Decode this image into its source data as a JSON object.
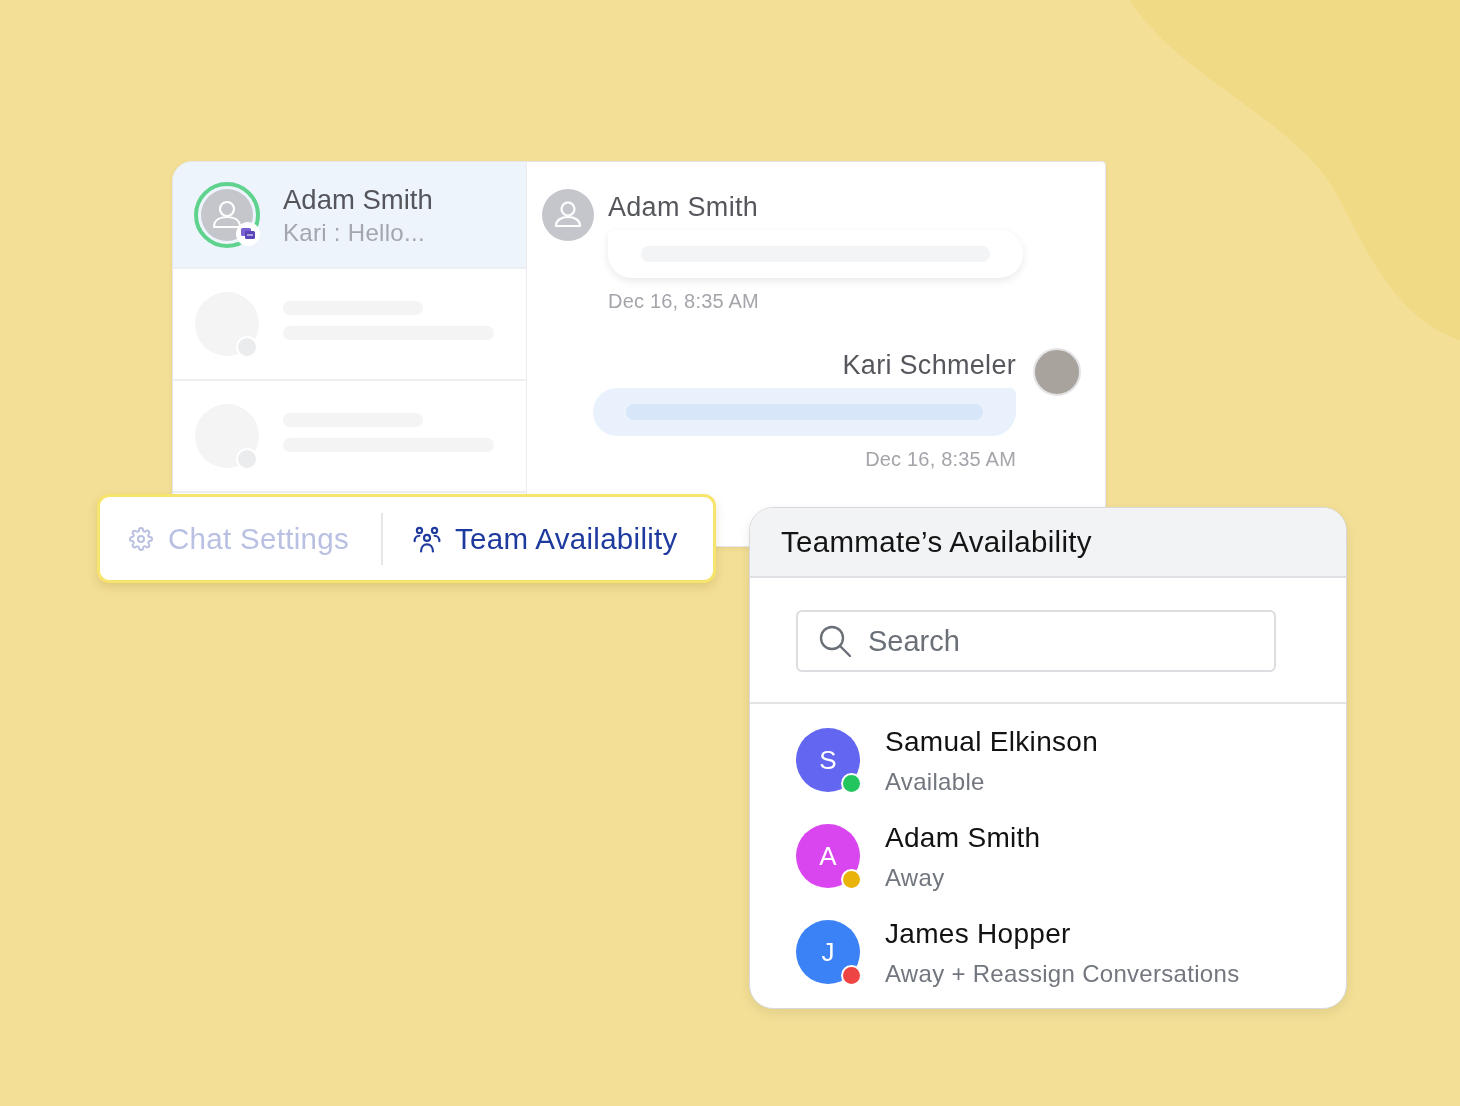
{
  "conversations": [
    {
      "kind": "contact",
      "name": "Adam Smith",
      "preview": "Kari : Hello...",
      "selected": true
    },
    {
      "kind": "placeholder",
      "selected": false
    },
    {
      "kind": "placeholder",
      "selected": false
    }
  ],
  "messages": [
    {
      "kind": "incoming",
      "sender": "Adam Smith",
      "time": "Dec 16, 8:35 AM"
    },
    {
      "kind": "outgoing",
      "sender": "Kari Schmeler",
      "time": "Dec 16, 8:35 AM"
    }
  ],
  "toolbar": {
    "tabs": [
      {
        "kind": "settings",
        "label": "Chat Settings",
        "selected": false
      },
      {
        "kind": "team",
        "label": "Team Availability",
        "selected": true
      }
    ]
  },
  "availability": {
    "title": "Teammate’s Availability",
    "search": {
      "placeholder": "Search"
    },
    "teammates": [
      {
        "name": "Samual Elkinson",
        "avatar": {
          "initial": "S",
          "color": "#6366f1"
        },
        "status": {
          "label": "Available",
          "color": "#22c55e"
        }
      },
      {
        "name": "Adam Smith",
        "avatar": {
          "initial": "A",
          "color": "#d946ef"
        },
        "status": {
          "label": "Away",
          "color": "#eab308"
        }
      },
      {
        "name": "James Hopper",
        "avatar": {
          "initial": "J",
          "color": "#3b82f6"
        },
        "status": {
          "label": "Away + Reassign Conversations",
          "color": "#ef4444"
        }
      }
    ]
  }
}
